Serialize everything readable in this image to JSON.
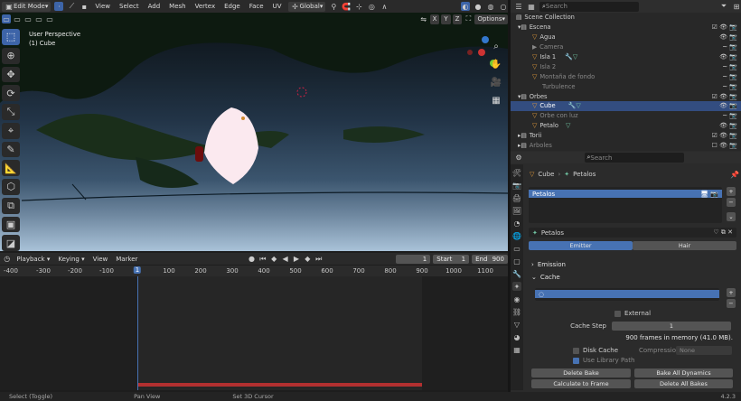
{
  "header": {
    "mode": "Edit Mode",
    "menus": [
      "View",
      "Select",
      "Add",
      "Mesh",
      "Vertex",
      "Edge",
      "Face",
      "UV"
    ],
    "transform_orientation": "Global",
    "axes": [
      "X",
      "Y",
      "Z"
    ],
    "options": "Options"
  },
  "viewport": {
    "perspective": "User Perspective",
    "object": "(1) Cube"
  },
  "timeline": {
    "menus": [
      "Playback",
      "Keying",
      "View",
      "Marker"
    ],
    "current_frame": "1",
    "start_label": "Start",
    "start": "1",
    "end_label": "End",
    "end": "900",
    "ruler": [
      "-400",
      "-300",
      "-200",
      "-100",
      "1",
      "100",
      "200",
      "300",
      "400",
      "500",
      "600",
      "700",
      "800",
      "900",
      "1000",
      "1100"
    ]
  },
  "status": {
    "items": [
      "Select (Toggle)",
      "Pan View",
      "Set 3D Cursor"
    ],
    "version": "4.2.3"
  },
  "outliner": {
    "search_placeholder": "Search",
    "rows": [
      {
        "label": "Scene Collection",
        "indent": 0
      },
      {
        "label": "Escena",
        "indent": 1
      },
      {
        "label": "Agua",
        "indent": 2
      },
      {
        "label": "Camera",
        "indent": 2,
        "dim": true
      },
      {
        "label": "Isla 1",
        "indent": 2
      },
      {
        "label": "Isla 2",
        "indent": 2,
        "dim": true
      },
      {
        "label": "Montaña de fondo",
        "indent": 2,
        "dim": true
      },
      {
        "label": "Turbulence",
        "indent": 2,
        "dim": true
      },
      {
        "label": "Orbes",
        "indent": 1
      },
      {
        "label": "Cube",
        "indent": 2,
        "selected": true
      },
      {
        "label": "Orbe con luz",
        "indent": 2,
        "dim": true
      },
      {
        "label": "Petalo",
        "indent": 2
      },
      {
        "label": "Torii",
        "indent": 1
      },
      {
        "label": "Arboles",
        "indent": 1,
        "dim": true
      }
    ]
  },
  "properties": {
    "search_placeholder": "Search",
    "breadcrumb": [
      "Cube",
      "Petalos"
    ],
    "particle_system": "Petalos",
    "settings_name": "Petalos",
    "type_tabs": [
      "Emitter",
      "Hair"
    ],
    "sections": {
      "emission": "Emission",
      "cache": "Cache"
    },
    "external": "External",
    "cache_step_label": "Cache Step",
    "cache_step": "1",
    "cache_info": "900 frames in memory (41.0 MB).",
    "disk_cache": "Disk Cache",
    "compression_label": "Compression",
    "compression": "None",
    "use_library_path": "Use Library Path",
    "buttons": [
      "Delete Bake",
      "Bake All Dynamics",
      "Calculate to Frame",
      "Delete All Bakes"
    ]
  },
  "colors": {
    "accent": "#4772b3",
    "selected_row": "#334d80",
    "frame_marker": "#4772b3",
    "cache_bar": "#b23030"
  }
}
